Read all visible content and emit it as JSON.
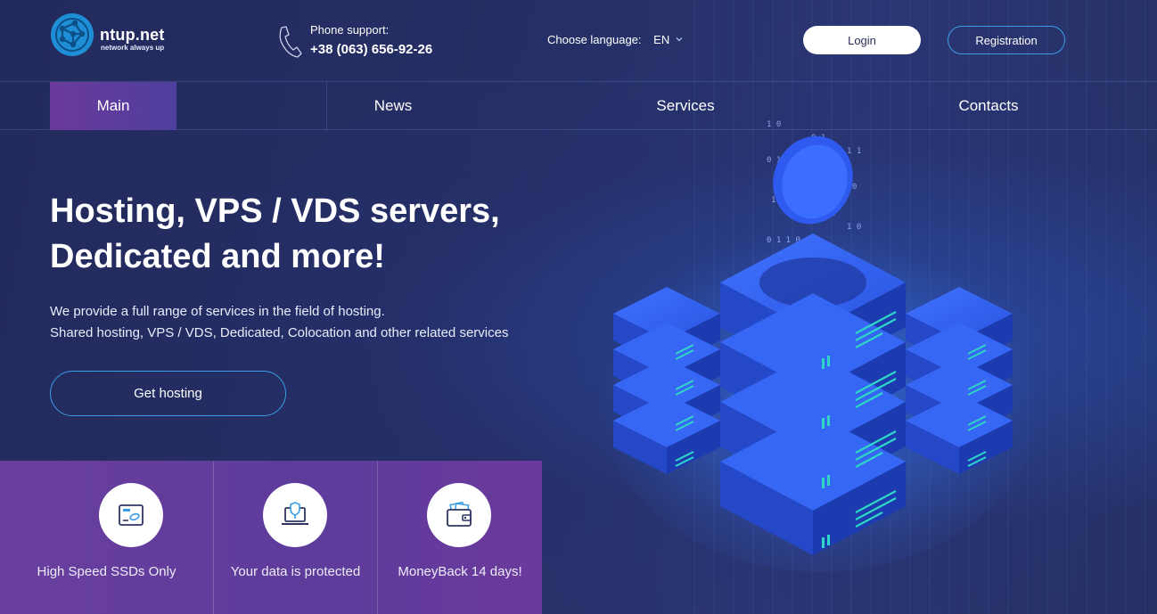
{
  "header": {
    "logo_name": "ntup.net",
    "logo_tagline": "network always up",
    "phone_label": "Phone support:",
    "phone_number": "+38 (063) 656-92-26",
    "language_label": "Choose language:",
    "language_value": "EN",
    "login_label": "Login",
    "registration_label": "Registration"
  },
  "nav": {
    "items": [
      {
        "label": "Main",
        "active": true
      },
      {
        "label": "News",
        "active": false
      },
      {
        "label": "Services",
        "active": false
      },
      {
        "label": "Contacts",
        "active": false
      }
    ]
  },
  "hero": {
    "title_line1": "Hosting, VPS / VDS servers,",
    "title_line2": "Dedicated and more!",
    "desc_line1": "We provide a full range of services in the field of hosting.",
    "desc_line2": "Shared hosting, VPS / VDS, Dedicated, Colocation and other related services",
    "cta_label": "Get hosting"
  },
  "features": [
    {
      "label": "High Speed SSDs Only",
      "icon": "ssd-icon"
    },
    {
      "label": "Your data is protected",
      "icon": "laptop-shield-icon"
    },
    {
      "label": "MoneyBack 14 days!",
      "icon": "wallet-icon"
    }
  ],
  "colors": {
    "background": "#232c5e",
    "accent_blue": "#3a9ee6",
    "active_nav": "#6a3a9a",
    "features_bg": "#6a3e9e",
    "server_blue": "#2f5ee8",
    "server_cyan": "#2fd6c8"
  }
}
